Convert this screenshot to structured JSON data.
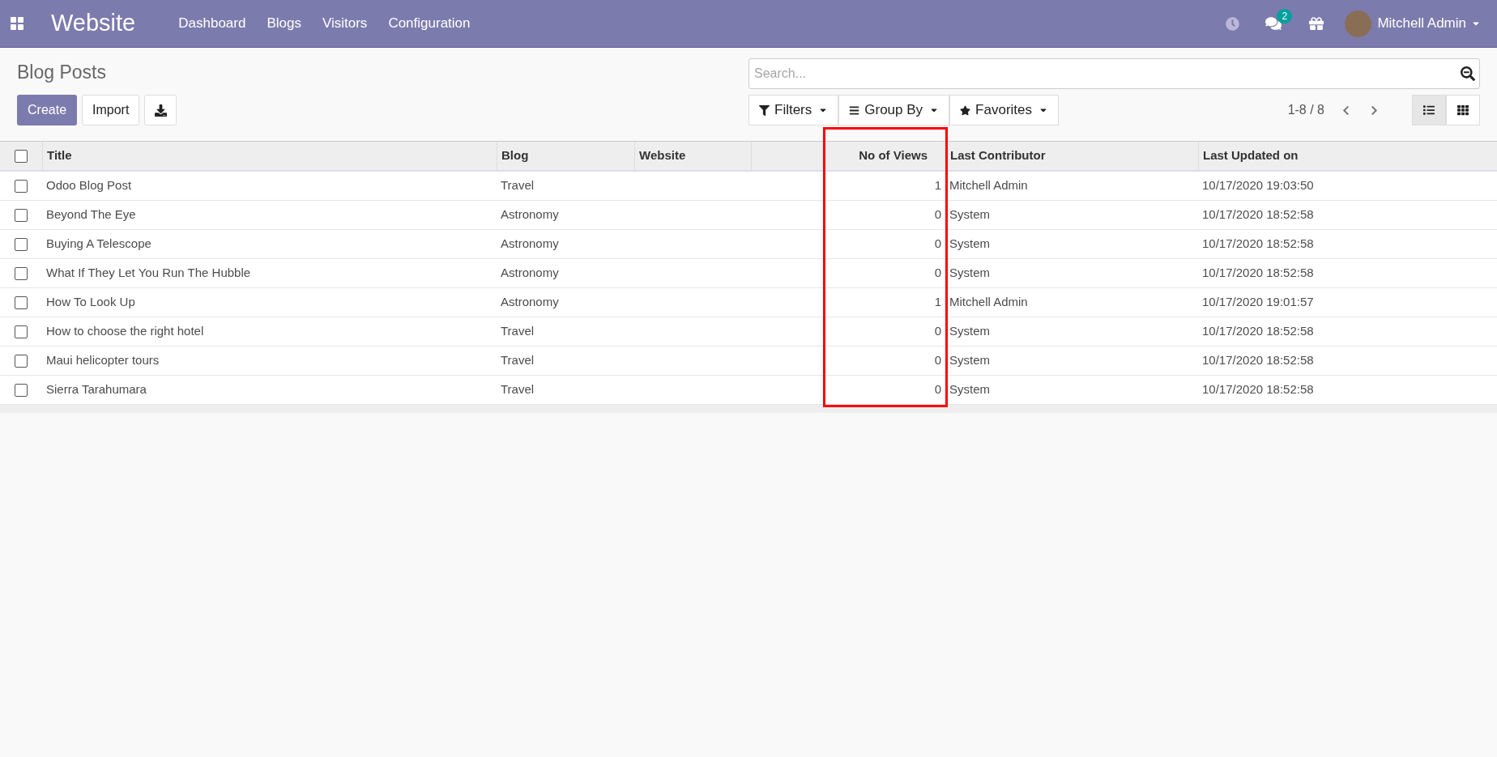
{
  "app_title": "Website",
  "menu": [
    "Dashboard",
    "Blogs",
    "Visitors",
    "Configuration"
  ],
  "systray": {
    "message_count": "2",
    "user": "Mitchell Admin"
  },
  "breadcrumb": "Blog Posts",
  "buttons": {
    "create": "Create",
    "import": "Import"
  },
  "search": {
    "placeholder": "Search..."
  },
  "filters": [
    "Filters",
    "Group By",
    "Favorites"
  ],
  "pager": "1-8 / 8",
  "views": [
    {
      "kind": "list",
      "selected": true
    },
    {
      "kind": "kanban",
      "selected": false
    }
  ],
  "table": {
    "select_all": {
      "checked": false
    },
    "columns": [
      {
        "label": "Title",
        "kind": "text",
        "highlighted": false
      },
      {
        "label": "Blog",
        "kind": "text",
        "highlighted": false
      },
      {
        "label": "Website",
        "kind": "text",
        "highlighted": false
      },
      {
        "label": "No of Views",
        "kind": "number",
        "highlighted": true
      },
      {
        "label": "Last Contributor",
        "kind": "text",
        "highlighted": false
      },
      {
        "label": "Last Updated on",
        "kind": "text",
        "highlighted": false
      }
    ],
    "rows": [
      {
        "checked": false,
        "cells": [
          "Odoo Blog Post",
          "Travel",
          "",
          "1",
          "Mitchell Admin",
          "10/17/2020 19:03:50"
        ]
      },
      {
        "checked": false,
        "cells": [
          "Beyond The Eye",
          "Astronomy",
          "",
          "0",
          "System",
          "10/17/2020 18:52:58"
        ]
      },
      {
        "checked": false,
        "cells": [
          "Buying A Telescope",
          "Astronomy",
          "",
          "0",
          "System",
          "10/17/2020 18:52:58"
        ]
      },
      {
        "checked": false,
        "cells": [
          "What If They Let You Run The Hubble",
          "Astronomy",
          "",
          "0",
          "System",
          "10/17/2020 18:52:58"
        ]
      },
      {
        "checked": false,
        "cells": [
          "How To Look Up",
          "Astronomy",
          "",
          "1",
          "Mitchell Admin",
          "10/17/2020 19:01:57"
        ]
      },
      {
        "checked": false,
        "cells": [
          "How to choose the right hotel",
          "Travel",
          "",
          "0",
          "System",
          "10/17/2020 18:52:58"
        ]
      },
      {
        "checked": false,
        "cells": [
          "Maui helicopter tours",
          "Travel",
          "",
          "0",
          "System",
          "10/17/2020 18:52:58"
        ]
      },
      {
        "checked": false,
        "cells": [
          "Sierra Tarahumara",
          "Travel",
          "",
          "0",
          "System",
          "10/17/2020 18:52:58"
        ]
      }
    ]
  }
}
